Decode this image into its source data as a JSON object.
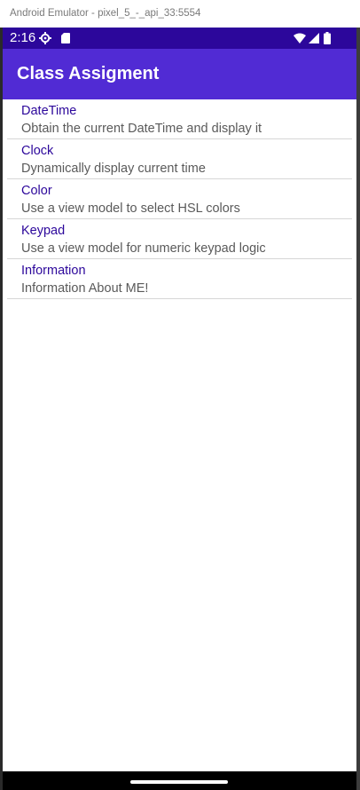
{
  "window": {
    "title": "Android Emulator - pixel_5_-_api_33:5554"
  },
  "status_bar": {
    "time": "2:16",
    "bg": "#2c079b"
  },
  "app_bar": {
    "title": "Class Assigment",
    "bg": "#512bd4"
  },
  "list": {
    "items": [
      {
        "title": "DateTime",
        "description": "Obtain the current DateTime and display it"
      },
      {
        "title": "Clock",
        "description": "Dynamically display current time"
      },
      {
        "title": "Color",
        "description": "Use a view model to select HSL colors"
      },
      {
        "title": "Keypad",
        "description": "Use a view model for numeric keypad logic"
      },
      {
        "title": "Information",
        "description": "Information About ME!"
      }
    ]
  },
  "icons": {
    "status": [
      "settings-gear-icon",
      "sd-card-icon",
      "wifi-icon",
      "cell-signal-icon",
      "battery-icon"
    ]
  }
}
